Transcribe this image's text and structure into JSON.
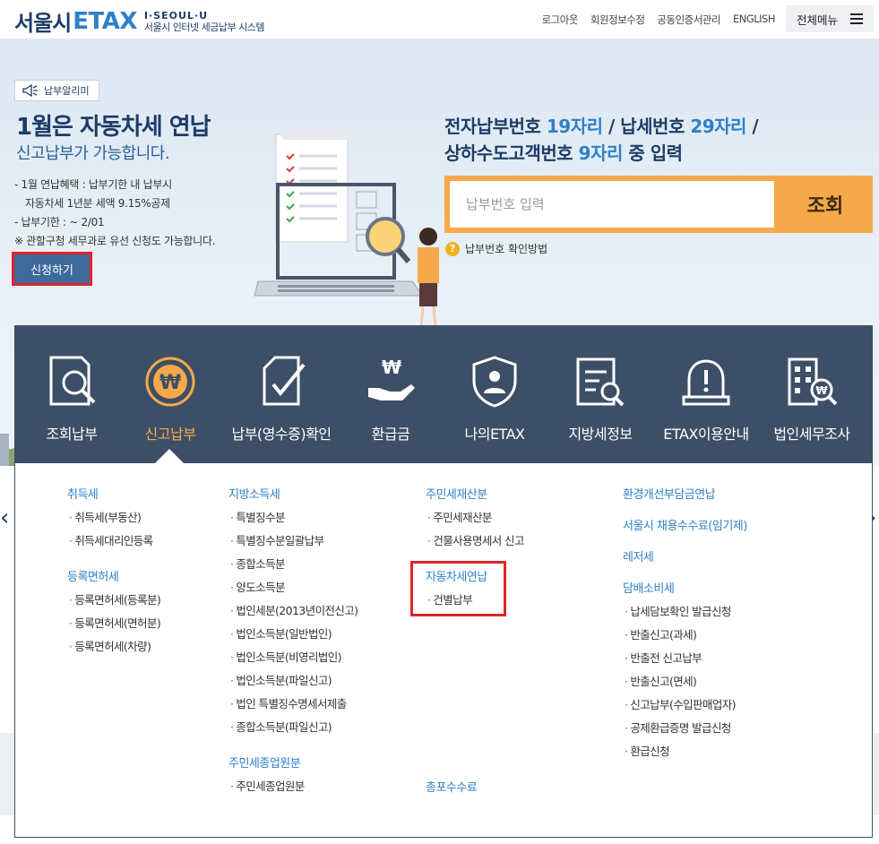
{
  "header": {
    "logo_city": "서울시",
    "logo_etax": "ETAX",
    "logo_sub1": "I·SEOUL·U",
    "logo_sub2": "서울시 인터넷 세금납부 시스템",
    "nav": [
      "로그아웃",
      "회원정보수정",
      "공동인증서관리",
      "ENGLISH"
    ],
    "all_menu": "전체메뉴"
  },
  "hero": {
    "badge": "납부알리미",
    "title": "1월은 자동차세 연납",
    "subtitle": "신고납부가 가능합니다.",
    "details": [
      "- 1월 연납혜택 : 납부기한 내 납부시",
      "  자동차세 1년분 세액 9.15%공제",
      "- 납부기한 : ~ 2/01",
      "※ 관할구청 세무과로 유선 신청도 가능합니다."
    ],
    "apply_button": "신청하기"
  },
  "search": {
    "title_line1_a": "전자납부번호 ",
    "title_line1_b": "19자리",
    "title_line1_c": " / 납세번호 ",
    "title_line1_d": "29자리",
    "title_line1_e": " /",
    "title_line2_a": "상하수도고객번호 ",
    "title_line2_b": "9자리",
    "title_line2_c": " 중 입력",
    "placeholder": "납부번호 입력",
    "button": "조회",
    "help": "납부번호 확인방법"
  },
  "menu": {
    "items": [
      {
        "label": "조회납부",
        "icon": "search-doc-icon"
      },
      {
        "label": "신고납부",
        "icon": "won-circle-icon"
      },
      {
        "label": "납부(영수증)확인",
        "icon": "check-doc-icon"
      },
      {
        "label": "환급금",
        "icon": "won-hand-icon"
      },
      {
        "label": "나의ETAX",
        "icon": "user-shield-icon"
      },
      {
        "label": "지방세정보",
        "icon": "list-search-icon"
      },
      {
        "label": "ETAX이용안내",
        "icon": "alert-siren-icon"
      },
      {
        "label": "법인세무조사",
        "icon": "building-search-icon"
      }
    ],
    "active_index": 1
  },
  "dropdown": {
    "col1": {
      "h1": "취득세",
      "h1_items": [
        "취득세(부동산)",
        "취득세대리인등록"
      ],
      "h2": "등록면허세",
      "h2_items": [
        "등록면허세(등록분)",
        "등록면허세(면허분)",
        "등록면허세(차량)"
      ]
    },
    "col2": {
      "h1": "지방소득세",
      "h1_items": [
        "특별징수분",
        "특별징수분일괄납부",
        "종합소득분",
        "양도소득분",
        "법인세분(2013년이전신고)",
        "법인소득분(일반법인)",
        "법인소득분(비영리법인)",
        "법인소득분(파일신고)",
        "법인 특별징수명세서제출",
        "종합소득분(파일신고)"
      ],
      "h2": "주민세종업원분",
      "h2_items": [
        "주민세종업원분"
      ]
    },
    "col3": {
      "h1": "주민세재산분",
      "h1_items": [
        "주민세재산분",
        "건물사용명세서 신고"
      ],
      "h2": "자동차세연납",
      "h2_items": [
        "건별납부"
      ],
      "h3": "총포수수료"
    },
    "col4": {
      "h1": "환경개선부담금연납",
      "h2": "서울시 채용수수료(임기제)",
      "h3": "레저세",
      "h4": "담배소비세",
      "h4_items": [
        "납세담보확인 발급신청",
        "반출신고(과세)",
        "반출전 신고납부",
        "반출신고(면세)",
        "신고납부(수입판매업자)",
        "공제환급증명 발급신청",
        "환급신청"
      ]
    }
  }
}
